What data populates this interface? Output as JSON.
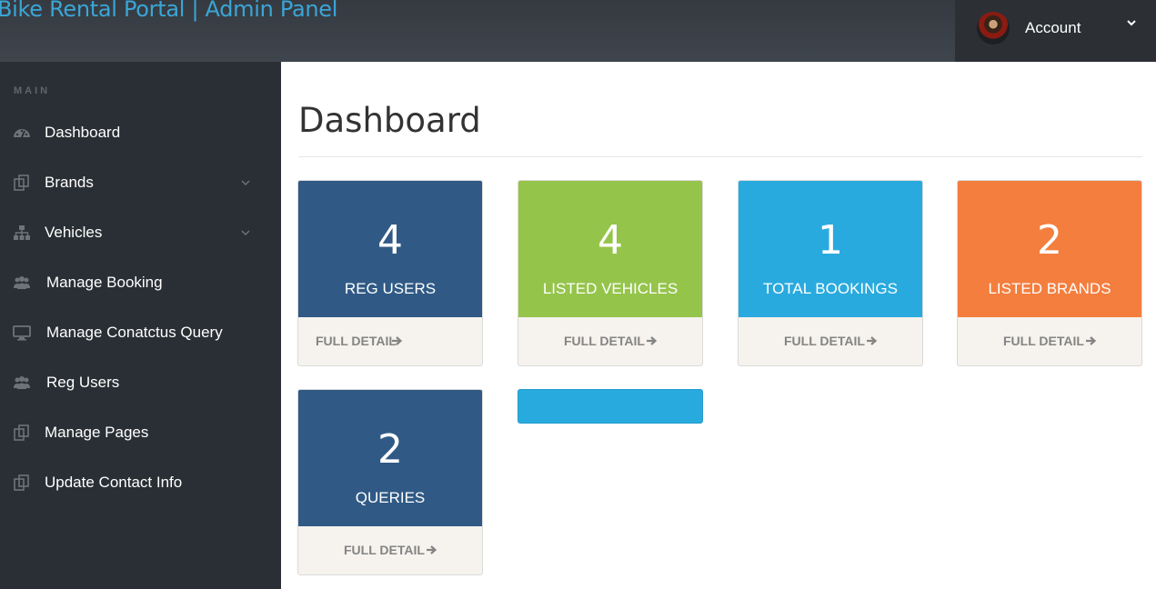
{
  "header": {
    "title": "Bike Rental Portal | Admin Panel",
    "account_label": "Account"
  },
  "sidebar": {
    "heading": "MAIN",
    "items": [
      {
        "label": "Dashboard",
        "icon": "dashboard-icon"
      },
      {
        "label": "Brands",
        "icon": "files-icon",
        "has_submenu": true
      },
      {
        "label": "Vehicles",
        "icon": "sitemap-icon",
        "has_submenu": true
      },
      {
        "label": "Manage Booking",
        "icon": "users-icon"
      },
      {
        "label": "Manage Conatctus Query",
        "icon": "desktop-icon"
      },
      {
        "label": "Reg Users",
        "icon": "users-icon"
      },
      {
        "label": "Manage Pages",
        "icon": "files-icon"
      },
      {
        "label": "Update Contact Info",
        "icon": "files-icon"
      }
    ]
  },
  "main": {
    "title": "Dashboard",
    "cards": [
      {
        "value": "4",
        "label": "REG USERS",
        "footer": "FULL DETAIL",
        "color": "#305a85"
      },
      {
        "value": "4",
        "label": "LISTED VEHICLES",
        "footer": "FULL DETAIL",
        "color": "#95c44b"
      },
      {
        "value": "1",
        "label": "TOTAL BOOKINGS",
        "footer": "FULL DETAIL",
        "color": "#29aade"
      },
      {
        "value": "2",
        "label": "LISTED BRANDS",
        "footer": "FULL DETAIL",
        "color": "#f47e3e"
      },
      {
        "value": "2",
        "label": "QUERIES",
        "footer": "FULL DETAIL",
        "color": "#305a85"
      }
    ],
    "extra_bar_color": "#29aade"
  },
  "colors": {
    "header_bg": "#3a4047",
    "sidebar_bg": "#2a2f35",
    "title_link": "#3aa6d6"
  }
}
